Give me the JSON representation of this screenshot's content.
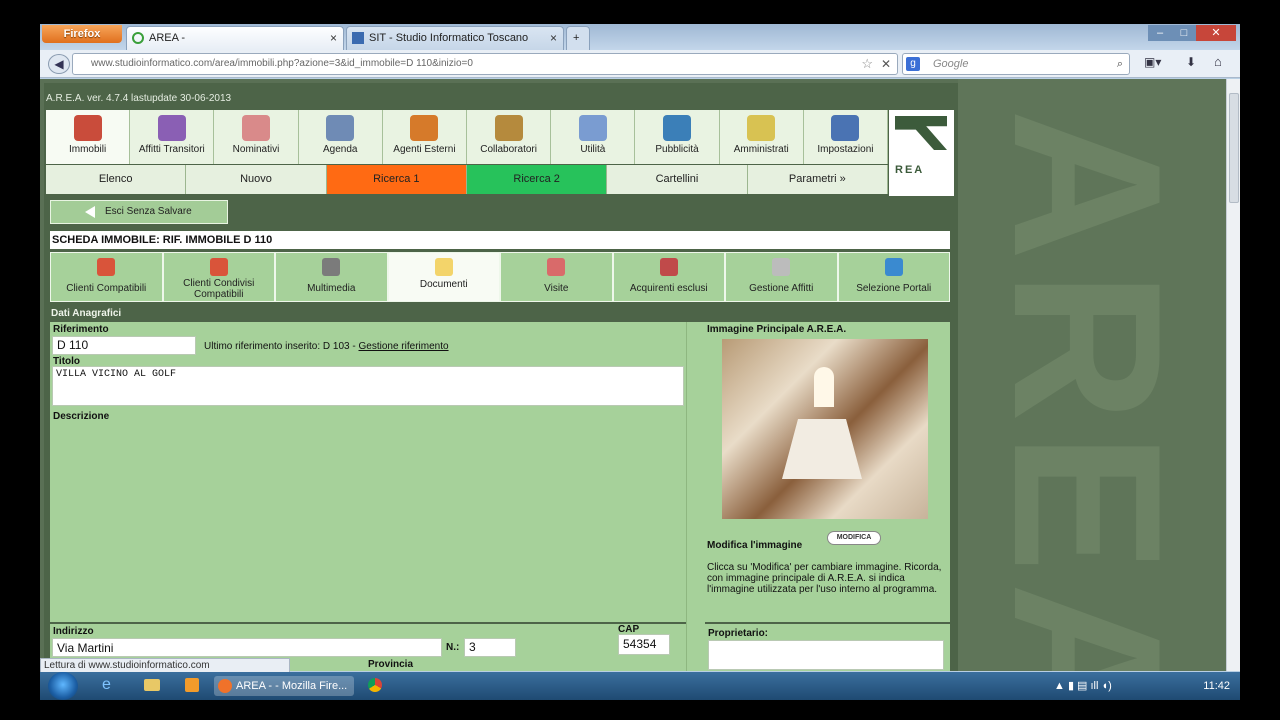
{
  "browser": {
    "menu_button": "Firefox",
    "tabs": [
      {
        "title": "AREA -",
        "close": "×"
      },
      {
        "title": "SIT - Studio Informatico Toscano",
        "close": "×"
      }
    ],
    "new_tab": "+",
    "url": "www.studioinformatico.com/area/immobili.php?azione=3&id_immobile=D 110&inizio=0",
    "search_placeholder": "Google",
    "status": "Lettura di www.studioinformatico.com"
  },
  "app": {
    "version": "A.R.E.A. ver. 4.7.4 lastupdate 30-06-2013",
    "logo_text": "REA",
    "menu": [
      "Immobili",
      "Affitti Transitori",
      "Nominativi",
      "Agenda",
      "Agenti Esterni",
      "Collaboratori",
      "Utilità",
      "Pubblicità",
      "Amministrati",
      "Impostazioni"
    ],
    "subnav": [
      {
        "label": "Elenco",
        "color": "#e6f0df"
      },
      {
        "label": "Nuovo",
        "color": "#e6f0df"
      },
      {
        "label": "Ricerca 1",
        "color": "#ff6a13"
      },
      {
        "label": "Ricerca 2",
        "color": "#27c25b"
      },
      {
        "label": "Cartellini",
        "color": "#e6f0df"
      },
      {
        "label": "Parametri »",
        "color": "#e6f0df"
      }
    ],
    "exit_button": "Esci Senza Salvare",
    "scheda_title": "SCHEDA IMMOBILE: RIF. IMMOBILE D 110",
    "toolbar": [
      {
        "label": "Clienti Compatibili",
        "lines": 1
      },
      {
        "label": "Clienti Condivisi Compatibili",
        "lines": 2
      },
      {
        "label": "Multimedia",
        "lines": 1
      },
      {
        "label": "Documenti",
        "lines": 1,
        "selected": true
      },
      {
        "label": "Visite",
        "lines": 1
      },
      {
        "label": "Acquirenti esclusi",
        "lines": 1
      },
      {
        "label": "Gestione Affitti",
        "lines": 1
      },
      {
        "label": "Selezione Portali",
        "lines": 1
      }
    ]
  },
  "form": {
    "section": "Dati Anagrafici",
    "riferimento_label": "Riferimento",
    "riferimento_value": "D 110",
    "ultimo_rif": "Ultimo riferimento inserito: D 103 -",
    "gestione_link": "Gestione riferimento",
    "titolo_label": "Titolo",
    "titolo_value": "VILLA VICINO AL GOLF",
    "descrizione_label": "Descrizione",
    "indirizzo_label": "Indirizzo",
    "indirizzo_value": "Via Martini",
    "n_label": "N.:",
    "n_value": "3",
    "cap_label": "CAP",
    "cap_value": "54354",
    "provincia_label": "Provincia",
    "image_title": "Immagine Principale A.R.E.A.",
    "modifica_label": "Modifica l'immagine",
    "modifica_button": "MODIFICA",
    "image_help": "Clicca su 'Modifica' per cambiare immagine. Ricorda, con immagine principale di A.R.E.A. si indica l'immagine utilizzata per l'uso interno al programma.",
    "proprietario_label": "Proprietario:"
  },
  "taskbar": {
    "active": "AREA - - Mozilla Fire...",
    "clock": "11:42"
  }
}
